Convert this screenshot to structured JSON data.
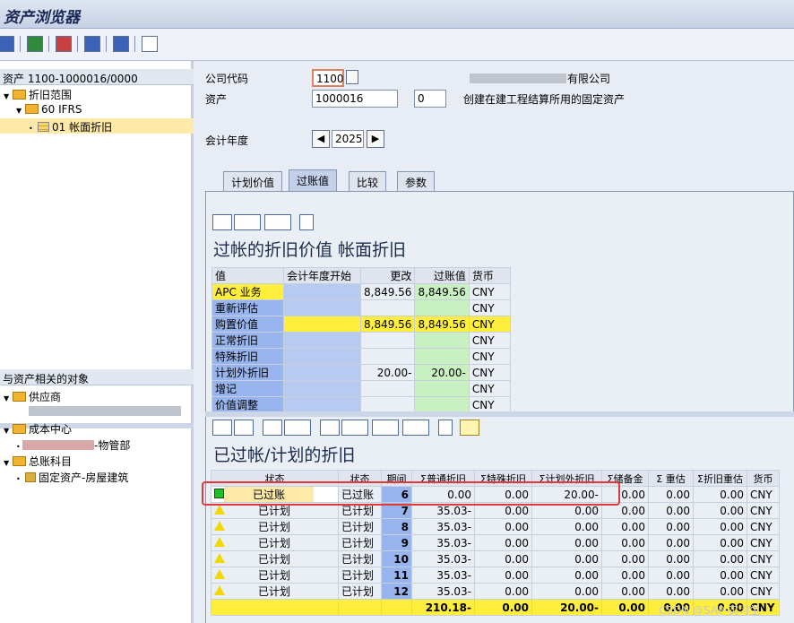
{
  "title": "资产浏览器",
  "left": {
    "header": "资产 1100-1000016/0000",
    "tree": [
      {
        "label": "折旧范围"
      },
      {
        "label": "60 IFRS"
      },
      {
        "label": "01 帐面折旧"
      }
    ],
    "related_header": "与资产相关的对象",
    "related": [
      {
        "label": "供应商"
      },
      {
        "label": "成本中心"
      },
      {
        "label": "-物管部"
      },
      {
        "label": "总账科目"
      },
      {
        "label": "固定资产-房屋建筑"
      }
    ]
  },
  "form": {
    "company_code_label": "公司代码",
    "company_code": "1100",
    "company_name": "有限公司",
    "asset_label": "资产",
    "asset_no": "1000016",
    "asset_sub": "0",
    "asset_desc": "创建在建工程结算所用的固定资产",
    "fiscal_year_label": "会计年度",
    "fiscal_year": "2025"
  },
  "tabs": [
    "计划价值",
    "过账值",
    "比较",
    "参数"
  ],
  "section1": {
    "title": "过帐的折旧价值 帐面折旧",
    "columns": [
      "值",
      "会计年度开始",
      "更改",
      "过账值",
      "货币"
    ],
    "rows": [
      {
        "name": "APC 业务",
        "start": "",
        "change": "8,849.56",
        "posted": "8,849.56",
        "cur": "CNY"
      },
      {
        "name": "重新评估",
        "start": "",
        "change": "",
        "posted": "",
        "cur": "CNY"
      },
      {
        "name": "购置价值",
        "start": "",
        "change": "8,849.56",
        "posted": "8,849.56",
        "cur": "CNY"
      },
      {
        "name": "正常折旧",
        "start": "",
        "change": "",
        "posted": "",
        "cur": "CNY"
      },
      {
        "name": "特殊折旧",
        "start": "",
        "change": "",
        "posted": "",
        "cur": "CNY"
      },
      {
        "name": "计划外折旧",
        "start": "",
        "change": "20.00-",
        "posted": "20.00-",
        "cur": "CNY"
      },
      {
        "name": "增记",
        "start": "",
        "change": "",
        "posted": "",
        "cur": "CNY"
      },
      {
        "name": "价值调整",
        "start": "",
        "change": "",
        "posted": "",
        "cur": "CNY"
      }
    ]
  },
  "section2": {
    "title": "已过帐/计划的折旧",
    "columns": [
      "状态",
      "状态",
      "期间",
      "Σ普通折旧",
      "Σ特殊折旧",
      "Σ计划外折旧",
      "Σ储备金",
      "Σ 重估",
      "Σ折旧重估",
      "货币"
    ],
    "rows": [
      {
        "icon": "green",
        "status": "已过账",
        "status2": "已过账",
        "period": "6",
        "normal": "0.00",
        "special": "0.00",
        "unplanned": "20.00-",
        "reserve": "0.00",
        "reval": "0.00",
        "depreval": "0.00",
        "cur": "CNY"
      },
      {
        "icon": "warn",
        "status": "已计划",
        "status2": "已计划",
        "period": "7",
        "normal": "35.03-",
        "special": "0.00",
        "unplanned": "0.00",
        "reserve": "0.00",
        "reval": "0.00",
        "depreval": "0.00",
        "cur": "CNY"
      },
      {
        "icon": "warn",
        "status": "已计划",
        "status2": "已计划",
        "period": "8",
        "normal": "35.03-",
        "special": "0.00",
        "unplanned": "0.00",
        "reserve": "0.00",
        "reval": "0.00",
        "depreval": "0.00",
        "cur": "CNY"
      },
      {
        "icon": "warn",
        "status": "已计划",
        "status2": "已计划",
        "period": "9",
        "normal": "35.03-",
        "special": "0.00",
        "unplanned": "0.00",
        "reserve": "0.00",
        "reval": "0.00",
        "depreval": "0.00",
        "cur": "CNY"
      },
      {
        "icon": "warn",
        "status": "已计划",
        "status2": "已计划",
        "period": "10",
        "normal": "35.03-",
        "special": "0.00",
        "unplanned": "0.00",
        "reserve": "0.00",
        "reval": "0.00",
        "depreval": "0.00",
        "cur": "CNY"
      },
      {
        "icon": "warn",
        "status": "已计划",
        "status2": "已计划",
        "period": "11",
        "normal": "35.03-",
        "special": "0.00",
        "unplanned": "0.00",
        "reserve": "0.00",
        "reval": "0.00",
        "depreval": "0.00",
        "cur": "CNY"
      },
      {
        "icon": "warn",
        "status": "已计划",
        "status2": "已计划",
        "period": "12",
        "normal": "35.03-",
        "special": "0.00",
        "unplanned": "0.00",
        "reserve": "0.00",
        "reval": "0.00",
        "depreval": "0.00",
        "cur": "CNY"
      }
    ],
    "totals": {
      "normal": "210.18-",
      "special": "0.00",
      "unplanned": "20.00-",
      "reserve": "0.00",
      "reval": "0.00",
      "depreval": "0.00",
      "cur": "CNY"
    }
  },
  "watermark": "CSDN @SAP-实习生"
}
